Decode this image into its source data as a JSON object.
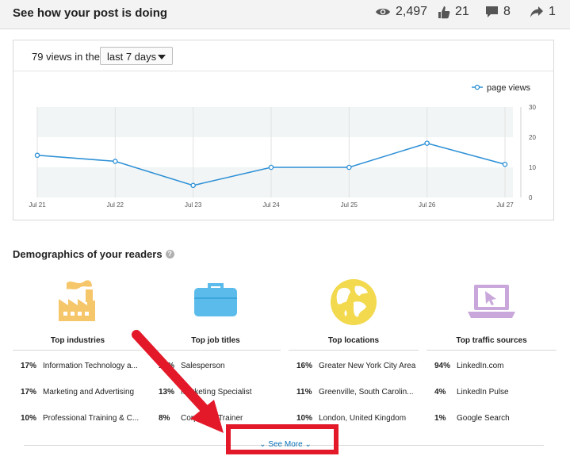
{
  "header": {
    "title": "See how your post is doing",
    "views": "2,497",
    "likes": "21",
    "comments": "8",
    "shares": "1"
  },
  "views_card": {
    "label": "79 views in the",
    "range_selected": "last 7 days"
  },
  "chart_data": {
    "type": "line",
    "categories": [
      "Jul 21",
      "Jul 22",
      "Jul 23",
      "Jul 24",
      "Jul 25",
      "Jul 26",
      "Jul 27"
    ],
    "series": [
      {
        "name": "page views",
        "values": [
          14,
          12,
          4,
          10,
          10,
          18,
          11
        ]
      }
    ],
    "ylim": [
      0,
      30
    ],
    "yticks": [
      "0",
      "10",
      "20",
      "30"
    ],
    "legend": "top-right",
    "line_color": "#2b8fd6"
  },
  "demographics": {
    "title": "Demographics of your readers",
    "help_icon": "?",
    "columns": [
      {
        "icon": "factory-icon",
        "title": "Top industries",
        "rows": [
          {
            "pct": "17%",
            "label": "Information Technology a..."
          },
          {
            "pct": "17%",
            "label": "Marketing and Advertising"
          },
          {
            "pct": "10%",
            "label": "Professional Training & C..."
          }
        ]
      },
      {
        "icon": "briefcase-icon",
        "title": "Top job titles",
        "rows": [
          {
            "pct": "16%",
            "label": "Salesperson"
          },
          {
            "pct": "13%",
            "label": "Marketing Specialist"
          },
          {
            "pct": "8%",
            "label": "Corporate Trainer"
          }
        ]
      },
      {
        "icon": "globe-icon",
        "title": "Top locations",
        "rows": [
          {
            "pct": "16%",
            "label": "Greater New York City Area"
          },
          {
            "pct": "11%",
            "label": "Greenville, South Carolin..."
          },
          {
            "pct": "10%",
            "label": "London, United Kingdom"
          }
        ]
      },
      {
        "icon": "laptop-cursor-icon",
        "title": "Top traffic sources",
        "rows": [
          {
            "pct": "94%",
            "label": "LinkedIn.com"
          },
          {
            "pct": "4%",
            "label": "LinkedIn Pulse"
          },
          {
            "pct": "1%",
            "label": "Google Search"
          }
        ]
      }
    ],
    "see_more": "See More"
  },
  "colors": {
    "accent": "#0b72b5",
    "annotation_red": "#e3192a",
    "factory": "#f6c66a",
    "briefcase": "#5bbcec",
    "globe": "#f2d94e",
    "laptop": "#c9a7db"
  }
}
